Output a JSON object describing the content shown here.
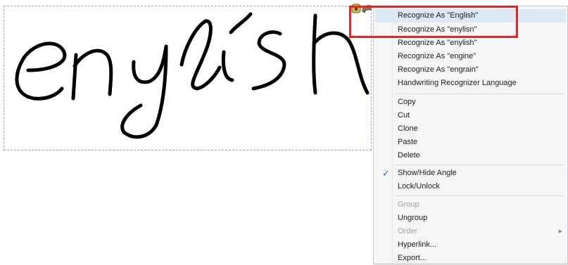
{
  "context_menu": {
    "items": [
      {
        "label": "Recognize As \"English\"",
        "enabled": true,
        "highlighted": true
      },
      {
        "label": "Recognize As \"enylisn\"",
        "enabled": true
      },
      {
        "label": "Recognize As \"enylish\"",
        "enabled": true
      },
      {
        "label": "Recognize As \"engine\"",
        "enabled": true
      },
      {
        "label": "Recognize As \"engrain\"",
        "enabled": true
      },
      {
        "label": "Handwriting Recognizer Language",
        "enabled": true
      },
      {
        "label": "Copy",
        "enabled": true
      },
      {
        "label": "Cut",
        "enabled": true
      },
      {
        "label": "Clone",
        "enabled": true
      },
      {
        "label": "Paste",
        "enabled": true
      },
      {
        "label": "Delete",
        "enabled": true
      },
      {
        "label": "Show/Hide Angle",
        "enabled": true,
        "checked": true
      },
      {
        "label": "Lock/Unlock",
        "enabled": true
      },
      {
        "label": "Group",
        "enabled": false
      },
      {
        "label": "Ungroup",
        "enabled": true
      },
      {
        "label": "Order",
        "enabled": false,
        "has_submenu": true
      },
      {
        "label": "Hyperlink...",
        "enabled": true
      },
      {
        "label": "Export...",
        "enabled": true
      }
    ]
  },
  "icons": {
    "check": "check-icon",
    "submenu": "submenu-arrow-icon",
    "handles": "selection-handle-icons"
  },
  "colors": {
    "highlight_border": "#e32626",
    "menu_background": "#f5f6f7",
    "hover_background": "#dde8f6",
    "selection_border": "#8fa6cf",
    "check_color": "#2b63b8",
    "ink": "#000000"
  }
}
